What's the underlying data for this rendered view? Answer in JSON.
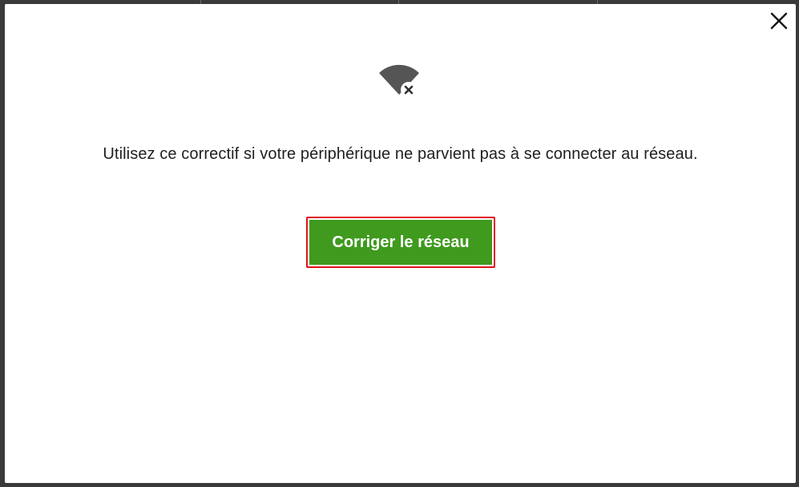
{
  "dialog": {
    "close_icon": "close-icon",
    "status_icon": "wifi-disconnected-icon",
    "message": "Utilisez ce correctif si votre périphérique ne parvient pas à se connecter au réseau.",
    "fix_button_label": "Corriger le réseau"
  },
  "colors": {
    "button_green": "#3f9a1e",
    "highlight_red": "#e3121b",
    "icon_gray": "#555555"
  }
}
